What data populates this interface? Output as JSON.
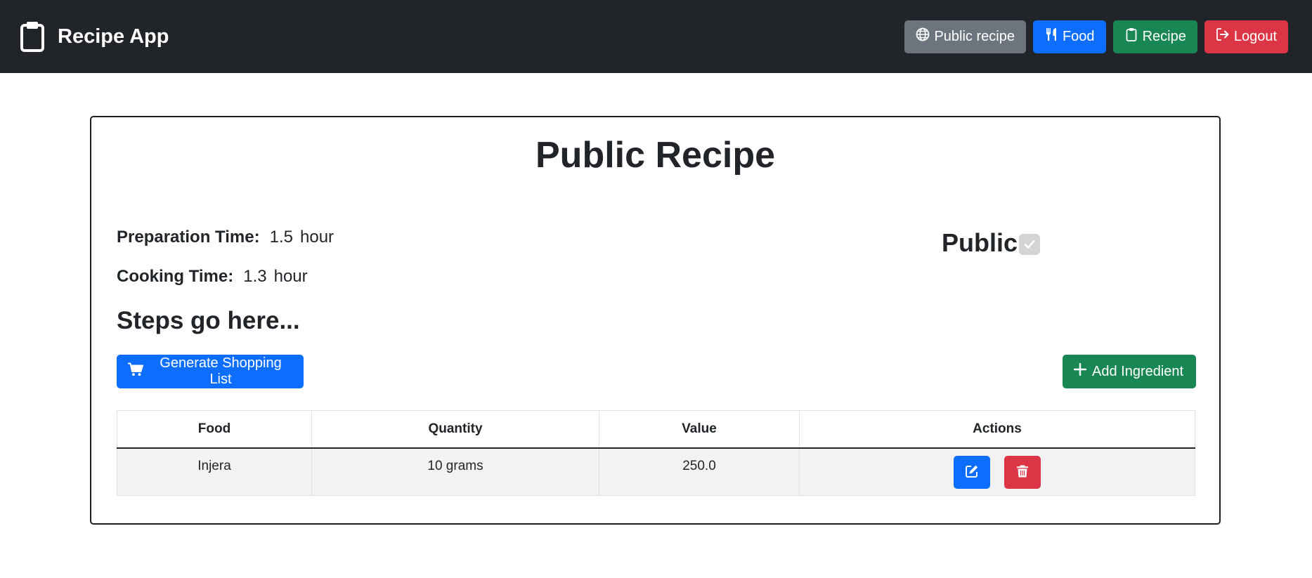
{
  "navbar": {
    "brand_icon": "clipboard-icon",
    "brand_title": "Recipe App",
    "buttons": [
      {
        "label": "Public recipe",
        "icon": "globe-icon",
        "color": "#6c757d"
      },
      {
        "label": "Food",
        "icon": "utensils-icon",
        "color": "#0d6efd"
      },
      {
        "label": "Recipe",
        "icon": "clipboard-icon",
        "color": "#198754"
      },
      {
        "label": "Logout",
        "icon": "logout-icon",
        "color": "#dc3545"
      }
    ]
  },
  "recipe": {
    "title": "Public Recipe",
    "preparation_label": "Preparation Time:",
    "preparation_value": "1.5",
    "preparation_unit": "hour",
    "cooking_label": "Cooking Time:",
    "cooking_value": "1.3",
    "cooking_unit": "hour",
    "public_label": "Public",
    "public_checked": true,
    "steps": "Steps go here..."
  },
  "actions": {
    "generate_label": "Generate Shopping List",
    "generate_icon": "cart-icon",
    "add_label": "Add Ingredient",
    "add_icon": "plus-icon"
  },
  "table": {
    "headers": [
      "Food",
      "Quantity",
      "Value",
      "Actions"
    ],
    "rows": [
      {
        "food": "Injera",
        "quantity": "10 grams",
        "value": "250.0",
        "actions": [
          "edit-icon",
          "trash-icon"
        ]
      }
    ]
  },
  "colors": {
    "navbar_bg": "#212529",
    "primary": "#0d6efd",
    "success": "#198754",
    "secondary": "#6c757d",
    "danger": "#dc3545"
  }
}
